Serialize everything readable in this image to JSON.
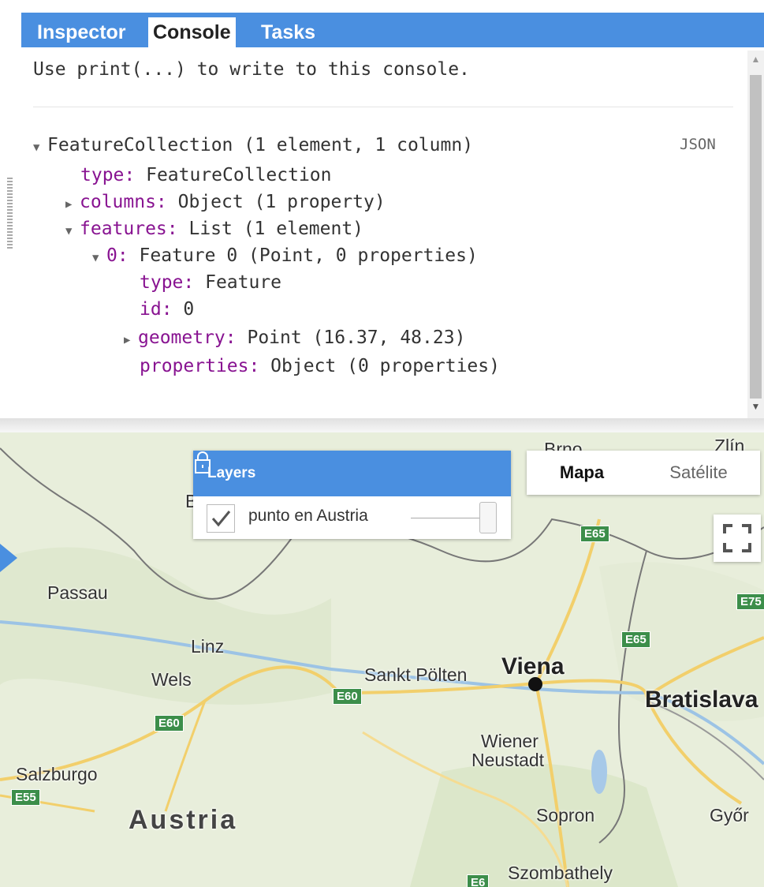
{
  "tabs": {
    "inspector": "Inspector",
    "console": "Console",
    "tasks": "Tasks"
  },
  "console": {
    "hint": "Use print(...) to write to this console.",
    "json_link": "JSON",
    "lines": {
      "root": "FeatureCollection (1 element, 1 column)",
      "type_key": "type:",
      "type_val": " FeatureCollection",
      "columns_key": "columns:",
      "columns_val": " Object (1 property)",
      "features_key": "features:",
      "features_val": " List (1 element)",
      "f0_key": "0:",
      "f0_val": " Feature 0 (Point, 0 properties)",
      "f0_type_key": "type:",
      "f0_type_val": " Feature",
      "f0_id_key": "id:",
      "f0_id_val": " 0",
      "f0_geom_key": "geometry:",
      "f0_geom_val": " Point (16.37, 48.23)",
      "f0_props_key": "properties:",
      "f0_props_val": " Object (0 properties)"
    }
  },
  "layers": {
    "title": "Layers",
    "items": [
      {
        "label": "punto en Austria",
        "checked": true,
        "opacity": 1.0
      }
    ]
  },
  "map_type": {
    "mapa": "Mapa",
    "satelite": "Satélite",
    "selected": "Mapa"
  },
  "map": {
    "cities": {
      "brno": "Brno",
      "zlin": "Zlín",
      "passau": "Passau",
      "linz": "Linz",
      "wels": "Wels",
      "sankt_polten": "Sankt Pölten",
      "viena": "Viena",
      "bratislava": "Bratislava",
      "wiener": "Wiener",
      "neustadt": "Neustadt",
      "salzburgo": "Salzburgo",
      "austria": "Austria",
      "sopron": "Sopron",
      "gyor": "Győr",
      "szombathely": "Szombathely",
      "b": "B"
    },
    "shields": {
      "e65a": "E65",
      "e65b": "E65",
      "e75": "E75",
      "e60a": "E60",
      "e60b": "E60",
      "e55": "E55",
      "e6x": "E6"
    }
  },
  "colors": {
    "accent": "#4a8fe0",
    "keyword": "#881391",
    "map_bg": "#e9efdc"
  }
}
